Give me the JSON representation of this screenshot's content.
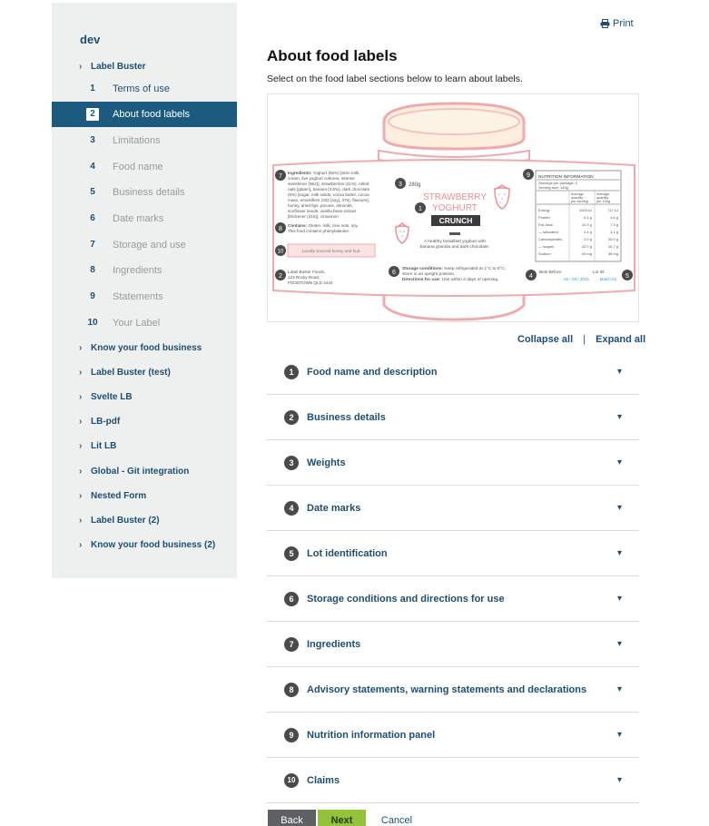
{
  "sidebar": {
    "title": "dev",
    "label_buster": "Label Buster",
    "steps": [
      {
        "num": "1",
        "label": "Terms of use"
      },
      {
        "num": "2",
        "label": "About food labels"
      },
      {
        "num": "3",
        "label": "Limitations"
      },
      {
        "num": "4",
        "label": "Food name"
      },
      {
        "num": "5",
        "label": "Business details"
      },
      {
        "num": "6",
        "label": "Date marks"
      },
      {
        "num": "7",
        "label": "Storage and use"
      },
      {
        "num": "8",
        "label": "Ingredients"
      },
      {
        "num": "9",
        "label": "Statements"
      },
      {
        "num": "10",
        "label": "Your Label"
      }
    ],
    "groups": [
      "Know your food business",
      "Label Buster (test)",
      "Svelte LB",
      "LB-pdf",
      "Lit LB",
      "Global - Git integration",
      "Nested Form",
      "Label Buster (2)",
      "Know your food business (2)"
    ]
  },
  "header": {
    "print": "Print",
    "title": "About food labels",
    "intro": "Select on the food label sections below to learn about labels."
  },
  "label_image": {
    "ingredients_heading": "Ingredients:",
    "ingredients_text": [
      "Yoghurt (55%) [skim milk,",
      "cream, live yoghurt cultures, intense",
      "sweetener (962)], strawberries (21%), rolled",
      "oats [gluten], banana (4.5%), dark chocolate",
      "(5%) [sugar, milk solids, cocoa butter, cocoa",
      "mass, emulsifiers (322 [soy], 476), flavours],",
      "honey, dried figs, pecans, almonds,",
      "sunflower seeds, vanilla bean extract",
      "[thickener (415)], cinnamon"
    ],
    "contains_heading": "Contains:",
    "contains_text": [
      "Gluten, milk, tree nuts, soy.",
      "This food contains phenylalanine."
    ],
    "honey_note": "Locally sourced honey and fruit.",
    "address": [
      "Label Buster Foods,",
      "123 Rocky Road,",
      "FOODTOWN QLD 4444"
    ],
    "weight": "280g",
    "name_line1": "STRAWBERRY",
    "name_line2": "YOGHURT",
    "name_line3": "CRUNCH",
    "description": [
      "A healthy breakfast yoghurt with",
      "banana granola and dark chocolate."
    ],
    "storage_heading": "Storage conditions:",
    "storage_text": " Keep refrigerated at 1°C to 5°C.",
    "storage_text2": "Store in an upright position.",
    "directions_heading": "Directions for use:",
    "directions_text": " Use within 2 days of opening.",
    "nip_title": "NUTRITION INFORMATION",
    "nip_servings": "Servings per package: 2",
    "nip_size": "Serving size: 140g",
    "nip_col1": [
      "Average",
      "quantity",
      "per serving"
    ],
    "nip_col2": [
      "Average",
      "quantity",
      "per 100g"
    ],
    "nip_rows": [
      {
        "name": "Energy",
        "a": "1004 kJ",
        "b": "717 kJ"
      },
      {
        "name": "Protein",
        "a": "6.4 g",
        "b": "4.6 g"
      },
      {
        "name": "Fat, total",
        "a": "10.3 g",
        "b": "7.3 g"
      },
      {
        "name": "— saturated",
        "a": "4.4 g",
        "b": "3.1 g"
      },
      {
        "name": "Carbohydrates",
        "a": "2.0 g",
        "b": "20.0 g"
      },
      {
        "name": "— sugars",
        "a": "22.0 g",
        "b": "15.7 g"
      },
      {
        "name": "Sodium",
        "a": "53 mg",
        "b": "38 mg"
      }
    ],
    "best_before_label": "Best Before:",
    "best_before_value": "03 / 04 / 2021",
    "lot_label": "Lot ID:",
    "lot_value": "Batch #2",
    "markers": [
      "1",
      "2",
      "3",
      "4",
      "5",
      "6",
      "7",
      "8",
      "9",
      "10"
    ]
  },
  "controls": {
    "collapse_all": "Collapse all",
    "separator": "|",
    "expand_all": "Expand all"
  },
  "accordion": [
    {
      "num": "1",
      "title": "Food name and description"
    },
    {
      "num": "2",
      "title": "Business details"
    },
    {
      "num": "3",
      "title": "Weights"
    },
    {
      "num": "4",
      "title": "Date marks"
    },
    {
      "num": "5",
      "title": "Lot identification"
    },
    {
      "num": "6",
      "title": "Storage conditions and directions for use"
    },
    {
      "num": "7",
      "title": "Ingredients"
    },
    {
      "num": "8",
      "title": "Advisory statements, warning statements and declarations"
    },
    {
      "num": "9",
      "title": "Nutrition information panel"
    },
    {
      "num": "10",
      "title": "Claims"
    }
  ],
  "buttons": {
    "back": "Back",
    "next": "Next",
    "cancel": "Cancel"
  },
  "colors": {
    "brand_blue": "#1d5a80",
    "link_blue": "#1d4e73",
    "next_green": "#94c23d",
    "label_pink": "#f0a9ad"
  }
}
